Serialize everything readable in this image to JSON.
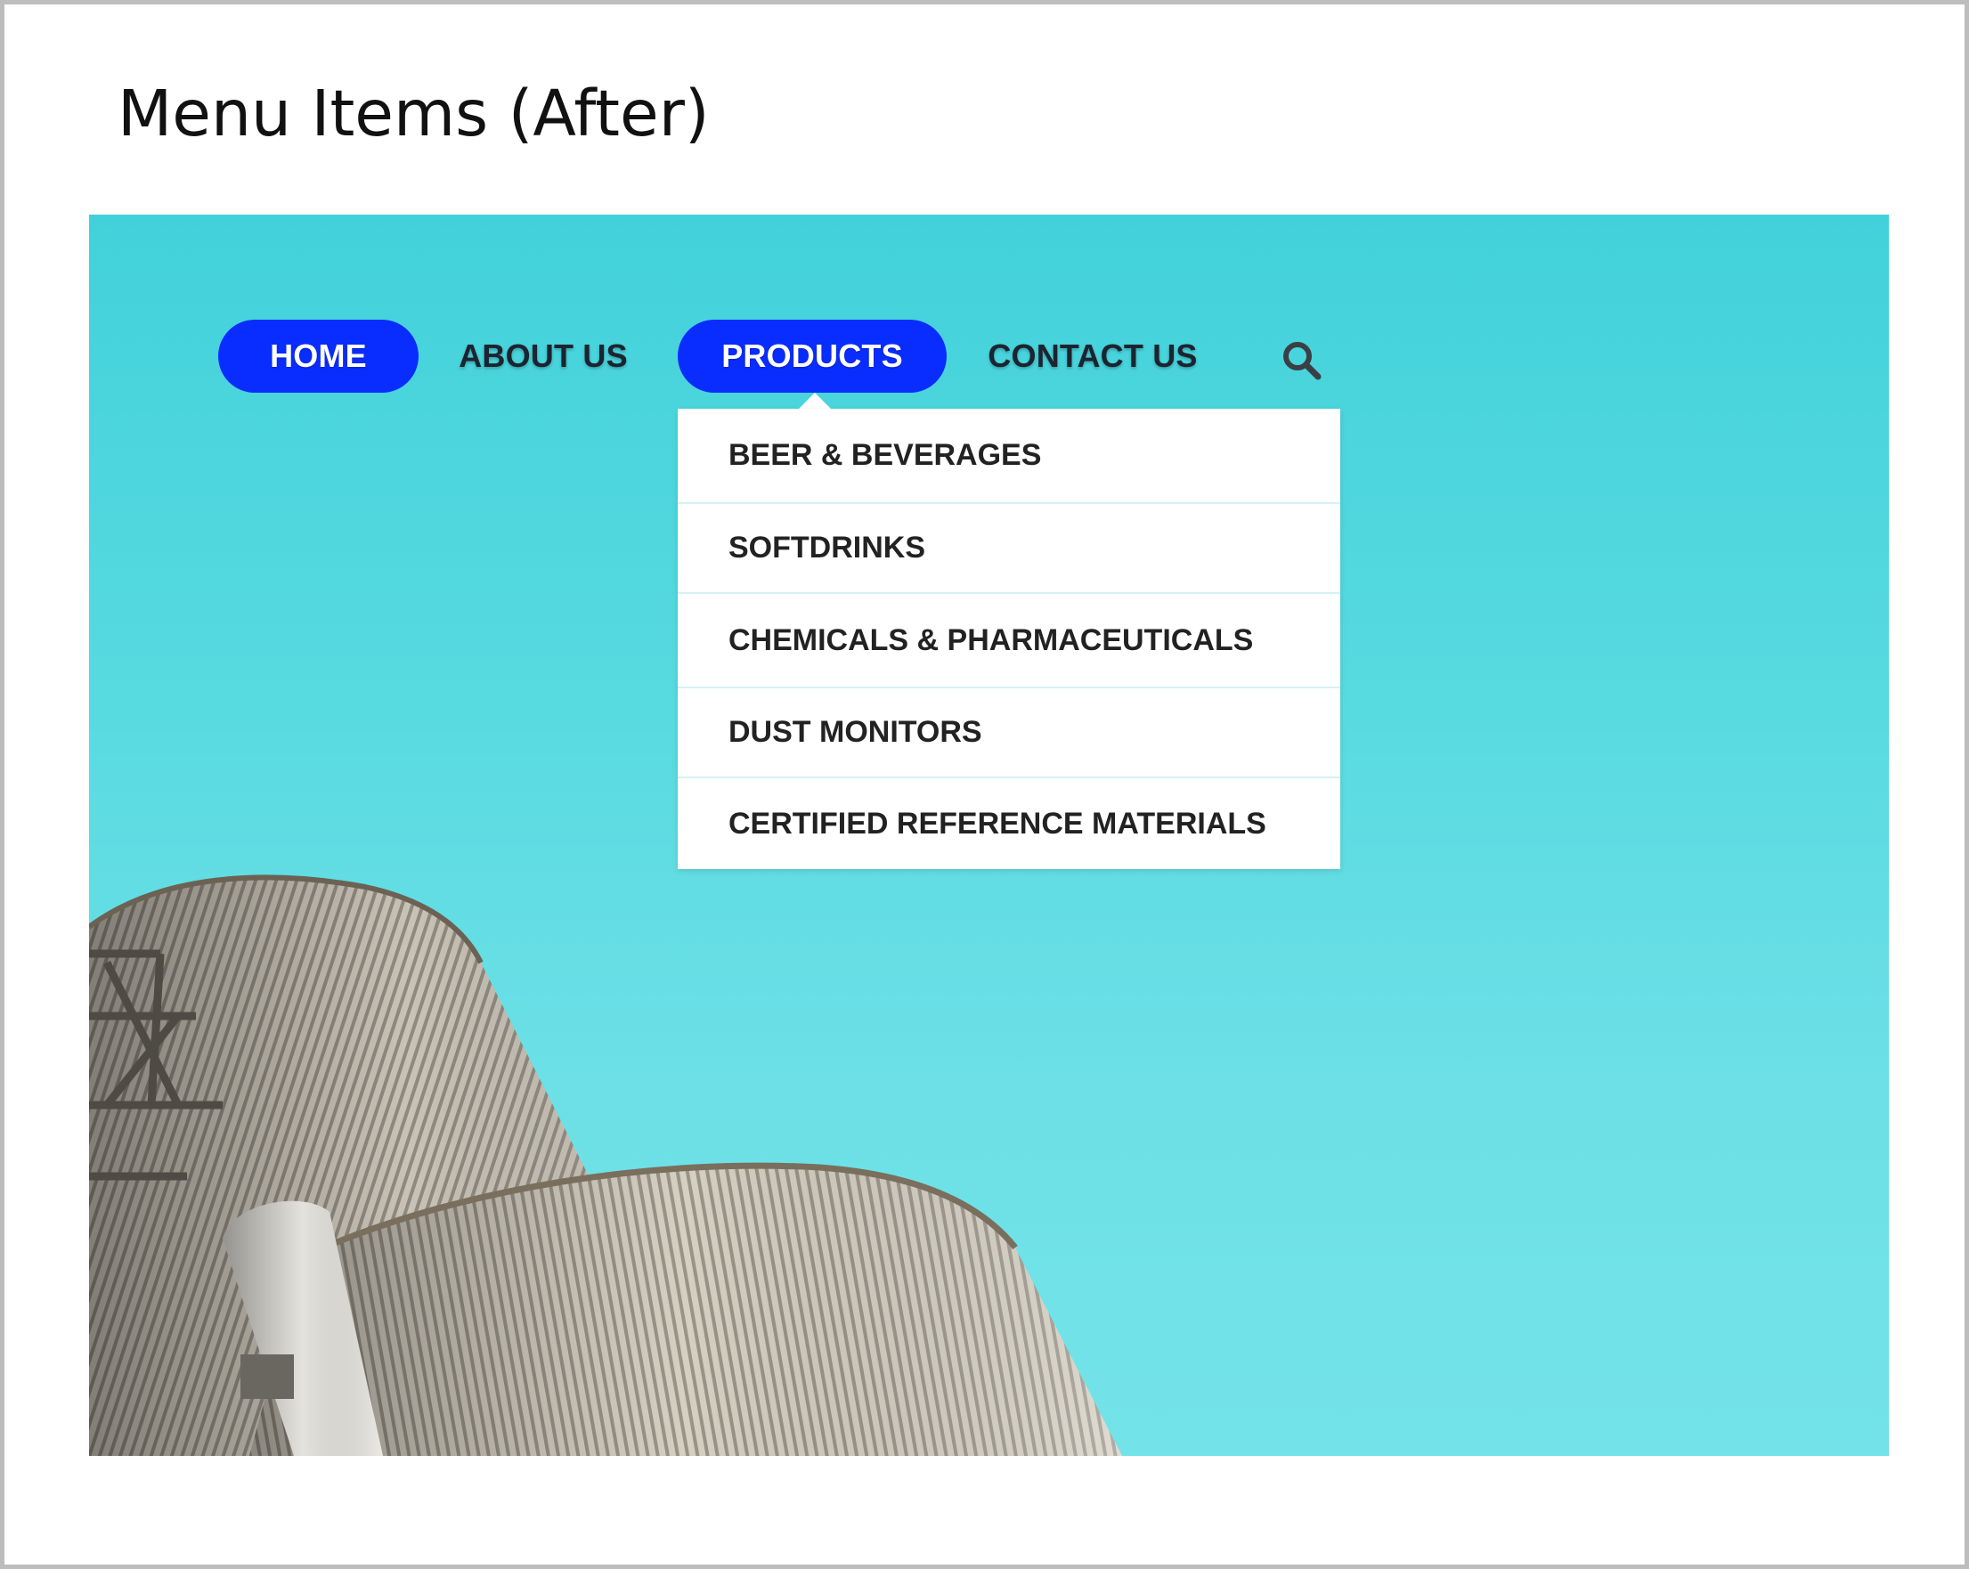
{
  "slide": {
    "title": "Menu Items (After)"
  },
  "nav": {
    "items": [
      {
        "label": "HOME",
        "active": true
      },
      {
        "label": "ABOUT US",
        "active": false
      },
      {
        "label": "PRODUCTS",
        "active": true
      },
      {
        "label": "CONTACT US",
        "active": false
      }
    ],
    "search_icon": "search-icon",
    "accent_color": "#0a2dff"
  },
  "products_dropdown": {
    "items": [
      {
        "label": "BEER & BEVERAGES"
      },
      {
        "label": "SOFTDRINKS"
      },
      {
        "label": "CHEMICALS & PHARMACEUTICALS"
      },
      {
        "label": "DUST MONITORS"
      },
      {
        "label": "CERTIFIED REFERENCE MATERIALS"
      }
    ]
  },
  "colors": {
    "sky": "#42d1da",
    "menu_text": "#1b2430",
    "pill": "#0a2dff"
  }
}
